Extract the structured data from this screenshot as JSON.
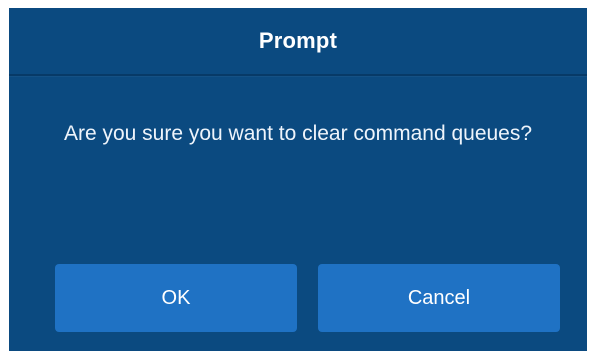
{
  "dialog": {
    "title": "Prompt",
    "message": "Are you sure you want to clear command queues?",
    "buttons": {
      "ok_label": "OK",
      "cancel_label": "Cancel"
    }
  },
  "colors": {
    "dialog_background": "#0b4a80",
    "button_background": "#1f72c4",
    "text": "#ffffff"
  }
}
